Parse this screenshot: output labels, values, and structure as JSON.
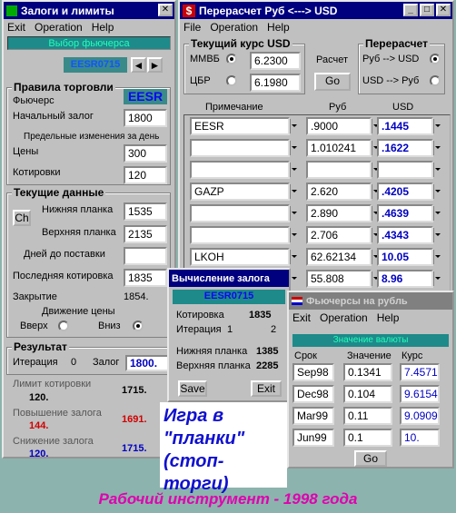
{
  "left": {
    "title": "Залоги и лимиты",
    "menu": [
      "Exit",
      "Operation",
      "Help"
    ],
    "status": "Выбор фьючерса",
    "contract": "EESR0715",
    "rules": {
      "heading": "Правила торговли",
      "futures_label": "Фьючерс",
      "futures_value": "EESR",
      "margin_label": "Начальный залог",
      "margin_value": "1800",
      "limits_label": "Предельные изменения за день",
      "prices_label": "Цены",
      "prices_value": "300",
      "quotes_label": "Котировки",
      "quotes_value": "120"
    },
    "current": {
      "heading": "Текущие данные",
      "ch_label": "Ch",
      "lower_label": "Нижняя планка",
      "lower_value": "1535",
      "upper_label": "Верхняя планка",
      "upper_value": "2135",
      "days_label": "Дней до поставки",
      "days_value": "",
      "last_label": "Последняя котировка",
      "last_value": "1835",
      "close_label": "Закрытие",
      "close_value": "1854.",
      "move_label": "Движение цены",
      "up_label": "Вверх",
      "down_label": "Вниз"
    },
    "result": {
      "heading": "Результат",
      "iter_label": "Итерация",
      "iter_value": "0",
      "margin_label": "Залог",
      "margin_value": "1800.",
      "limit_label": "Лимит котировки",
      "limit_a": "120.",
      "limit_b": "1715.",
      "raise_label": "Повышение залога",
      "raise_a": "144.",
      "raise_b": "1691.",
      "lower_label": "Снижение залога",
      "lower_a": "120.",
      "lower_b": "1715."
    }
  },
  "usd": {
    "title": "Перерасчет Руб <---> USD",
    "menu": [
      "File",
      "Operation",
      "Help"
    ],
    "rate_heading": "Текущий курс USD",
    "mmvb_label": "ММВБ",
    "mmvb_value": "6.2300",
    "cbr_label": "ЦБР",
    "cbr_value": "6.1980",
    "calc_label": "Расчет",
    "go_label": "Go",
    "recalc_heading": "Перерасчет",
    "rub_usd": "Руб --> USD",
    "usd_rub": "USD --> Руб",
    "col_note": "Примечание",
    "col_rub": "Руб",
    "col_usd": "USD",
    "rows": [
      {
        "note": "EESR",
        "rub": ".9000",
        "usd": ".1445"
      },
      {
        "note": "",
        "rub": "1.010241",
        "usd": ".1622"
      },
      {
        "note": "",
        "rub": "",
        "usd": ""
      },
      {
        "note": "GAZP",
        "rub": "2.620",
        "usd": ".4205"
      },
      {
        "note": "",
        "rub": "2.890",
        "usd": ".4639"
      },
      {
        "note": "",
        "rub": "2.706",
        "usd": ".4343"
      },
      {
        "note": "LKOH",
        "rub": "62.62134",
        "usd": "10.05"
      },
      {
        "note": "",
        "rub": "55.808",
        "usd": "8.96"
      }
    ]
  },
  "calc": {
    "title": "Вычисление залога",
    "contract": "EESR0715",
    "quote_label": "Котировка",
    "quote_value": "1835",
    "iter_label": "Итерация",
    "iter_value": "1",
    "iter_right": "2",
    "lower_label": "Нижняя планка",
    "lower_value": "1385",
    "upper_label": "Верхняя планка",
    "upper_value": "2285",
    "save_label": "Save",
    "exit_label": "Exit"
  },
  "fut": {
    "title": "Фьючерсы на рубль",
    "menu": [
      "Exit",
      "Operation",
      "Help"
    ],
    "status": "Значение валюты",
    "col_term": "Срок",
    "col_value": "Значение",
    "col_rate": "Курс",
    "rows": [
      {
        "term": "Sep98",
        "value": "0.1341",
        "rate": "7.4571"
      },
      {
        "term": "Dec98",
        "value": "0.104",
        "rate": "9.6154"
      },
      {
        "term": "Mar99",
        "value": "0.11",
        "rate": "9.0909"
      },
      {
        "term": "Jun99",
        "value": "0.1",
        "rate": "10."
      }
    ],
    "go_label": "Go"
  },
  "caption": {
    "line1": "Игра в",
    "line2": "\"планки\"",
    "line3": "(стоп-торги)"
  },
  "footer": "Рабочий инструмент - 1998 года"
}
